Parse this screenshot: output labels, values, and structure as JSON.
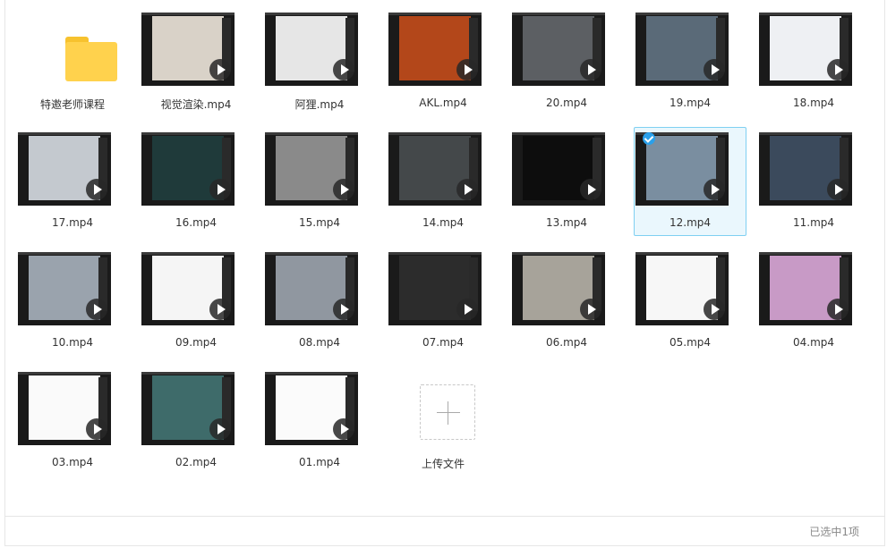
{
  "folder": {
    "label": "特邀老师课程",
    "icon": "folder-icon",
    "color": "#ffd24d"
  },
  "videos": [
    {
      "label": "视觉渲染.mp4",
      "thumb": "#d9d2c8",
      "selected": false
    },
    {
      "label": "阿狸.mp4",
      "thumb": "#e6e6e6",
      "selected": false
    },
    {
      "label": "AKL.mp4",
      "thumb": "#b3471a",
      "selected": false
    },
    {
      "label": "20.mp4",
      "thumb": "#5c5f63",
      "selected": false
    },
    {
      "label": "19.mp4",
      "thumb": "#5a6a78",
      "selected": false
    },
    {
      "label": "18.mp4",
      "thumb": "#eef0f3",
      "selected": false
    },
    {
      "label": "17.mp4",
      "thumb": "#c4c9cf",
      "selected": false
    },
    {
      "label": "16.mp4",
      "thumb": "#1f3a3a",
      "selected": false
    },
    {
      "label": "15.mp4",
      "thumb": "#8a8a8a",
      "selected": false
    },
    {
      "label": "14.mp4",
      "thumb": "#44484a",
      "selected": false
    },
    {
      "label": "13.mp4",
      "thumb": "#0d0d0d",
      "selected": false
    },
    {
      "label": "12.mp4",
      "thumb": "#7a8ea0",
      "selected": true
    },
    {
      "label": "11.mp4",
      "thumb": "#3b4a5c",
      "selected": false
    },
    {
      "label": "10.mp4",
      "thumb": "#9aa3ad",
      "selected": false
    },
    {
      "label": "09.mp4",
      "thumb": "#f5f5f5",
      "selected": false
    },
    {
      "label": "08.mp4",
      "thumb": "#9097a0",
      "selected": false
    },
    {
      "label": "07.mp4",
      "thumb": "#2c2c2c",
      "selected": false
    },
    {
      "label": "06.mp4",
      "thumb": "#a7a39a",
      "selected": false
    },
    {
      "label": "05.mp4",
      "thumb": "#f7f7f7",
      "selected": false
    },
    {
      "label": "04.mp4",
      "thumb": "#c89ac6",
      "selected": false
    },
    {
      "label": "03.mp4",
      "thumb": "#fafafa",
      "selected": false
    },
    {
      "label": "02.mp4",
      "thumb": "#3e6b6a",
      "selected": false
    },
    {
      "label": "01.mp4",
      "thumb": "#fbfbfb",
      "selected": false
    }
  ],
  "upload": {
    "label": "上传文件",
    "icon": "plus-icon"
  },
  "status": {
    "text": "已选中1项"
  },
  "colors": {
    "selected_bg": "#eaf7fd",
    "selected_border": "#7fd0f2",
    "check": "#2aa0ea"
  }
}
